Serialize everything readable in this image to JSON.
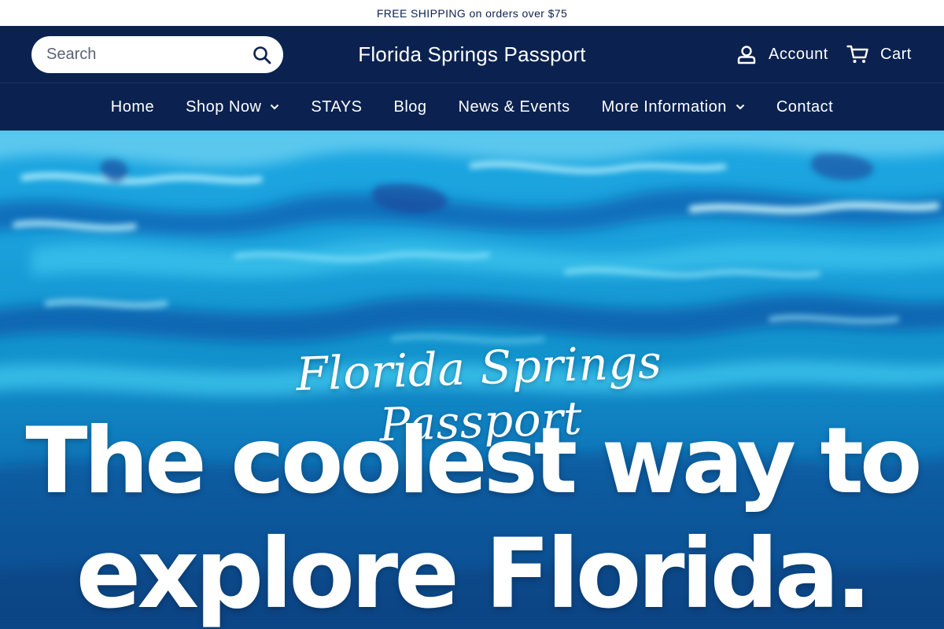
{
  "announcement": {
    "text": "FREE SHIPPING on orders over $75"
  },
  "header": {
    "search_placeholder": "Search",
    "site_title": "Florida Springs Passport",
    "account_label": "Account",
    "cart_label": "Cart"
  },
  "icons": {
    "search": "search-icon",
    "account": "user-icon",
    "cart": "cart-icon",
    "dropdown": "chevron-down-icon"
  },
  "nav": {
    "items": [
      {
        "label": "Home",
        "has_dropdown": false
      },
      {
        "label": "Shop Now",
        "has_dropdown": true
      },
      {
        "label": "STAYS",
        "has_dropdown": false
      },
      {
        "label": "Blog",
        "has_dropdown": false
      },
      {
        "label": "News & Events",
        "has_dropdown": false
      },
      {
        "label": "More Information",
        "has_dropdown": true
      },
      {
        "label": "Contact",
        "has_dropdown": false
      }
    ]
  },
  "hero": {
    "script_title": "Florida Springs Passport",
    "headline_line1": "The coolest way to",
    "headline_line2": "explore Florida."
  },
  "colors": {
    "brand_navy": "#0b2250",
    "announcement_bg": "#ffffff",
    "water_light": "#1da7e2",
    "water_deep": "#0b4b8c"
  }
}
